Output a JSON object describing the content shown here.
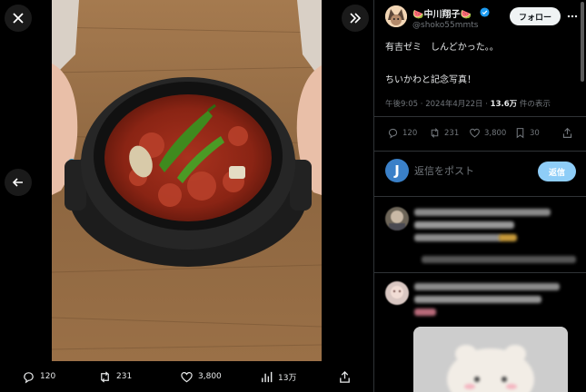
{
  "media_actions": {
    "replies": "120",
    "reposts": "231",
    "likes": "3,800",
    "views": "13万"
  },
  "tweet": {
    "display_name": "🍉中川翔子🍉",
    "handle": "@shoko55mmts",
    "follow_label": "フォロー",
    "text_line_1": "有吉ゼミ　しんどかった。。",
    "text_line_2": "ちいかわと記念写真！",
    "time": "午後9:05",
    "date": "2024年4月22日",
    "views_count": "13.6万",
    "views_suffix": "件の表示",
    "dot": "·"
  },
  "stats": {
    "replies": "120",
    "reposts": "231",
    "likes": "3,800",
    "bookmarks": "30"
  },
  "reply_box": {
    "avatar_letter": "J",
    "placeholder": "返信をポスト",
    "button_label": "返信"
  },
  "colors": {
    "accent": "#1d9bf0",
    "reply_button": "#8ecdf7",
    "follow_button": "#eff3f4",
    "muted_text": "#71767b"
  }
}
